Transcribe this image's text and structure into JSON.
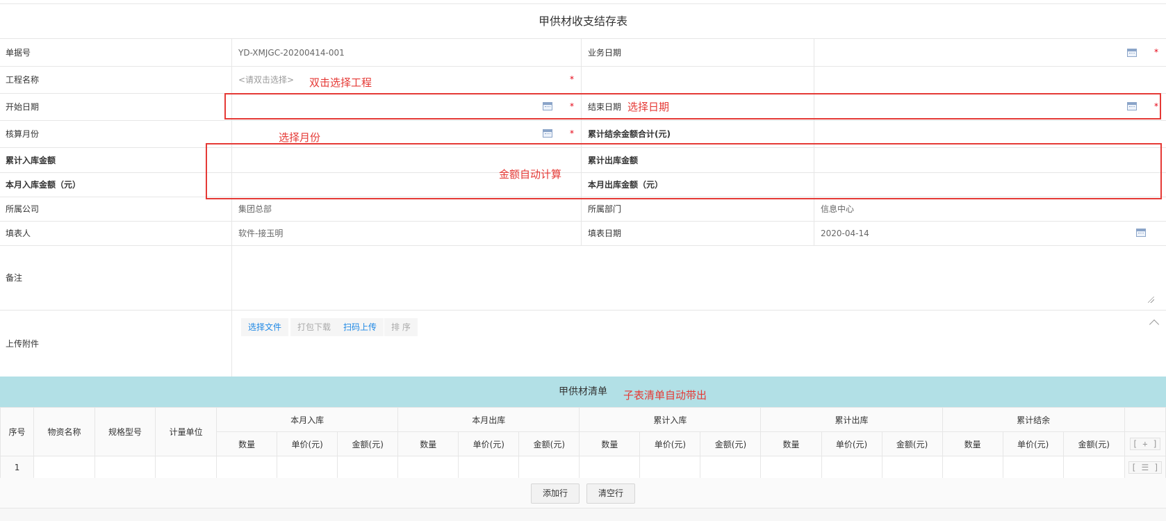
{
  "form": {
    "title": "甲供材收支结存表"
  },
  "fields": {
    "doc_no_label": "单据号",
    "doc_no_value": "YD-XMJGC-20200414-001",
    "biz_date_label": "业务日期",
    "project_label": "工程名称",
    "project_placeholder": "<请双击选择>",
    "start_date_label": "开始日期",
    "end_date_label": "结束日期",
    "month_label": "核算月份",
    "total_balance_label": "累计结余金额合计(元)",
    "cum_in_label": "累计入库金额",
    "cum_out_label": "累计出库金额",
    "month_in_label": "本月入库金额（元）",
    "month_out_label": "本月出库金额（元）",
    "company_label": "所属公司",
    "company_value": "集团总部",
    "dept_label": "所属部门",
    "dept_value": "信息中心",
    "filler_label": "填表人",
    "filler_value": "软件-接玉明",
    "fill_date_label": "填表日期",
    "fill_date_value": "2020-04-14",
    "remark_label": "备注",
    "upload_label": "上传附件",
    "required_mark": "*"
  },
  "upload": {
    "select_file": "选择文件",
    "pack_download": "打包下载",
    "scan_upload": "扫码上传",
    "sort": "排 序"
  },
  "annotations": {
    "project": "双击选择工程",
    "date": "选择日期",
    "month": "选择月份",
    "amount": "金额自动计算",
    "subtable": "子表清单自动带出"
  },
  "subtable": {
    "title": "甲供材清单",
    "headers": {
      "seq": "序号",
      "name": "物资名称",
      "spec": "规格型号",
      "unit": "计量单位",
      "groups": [
        "本月入库",
        "本月出库",
        "累计入库",
        "累计出库",
        "累计结余"
      ],
      "sub": [
        "数量",
        "单价(元)",
        "金额(元)"
      ]
    },
    "add_tool": "[ + ]",
    "row_tool": "[ ☰ ]",
    "rows": [
      {
        "seq": "1"
      }
    ],
    "add_row": "添加行",
    "clear_rows": "清空行"
  },
  "colors": {
    "annotation_red": "#e53935",
    "band": "#b2e0e6",
    "link": "#1e88e5"
  }
}
